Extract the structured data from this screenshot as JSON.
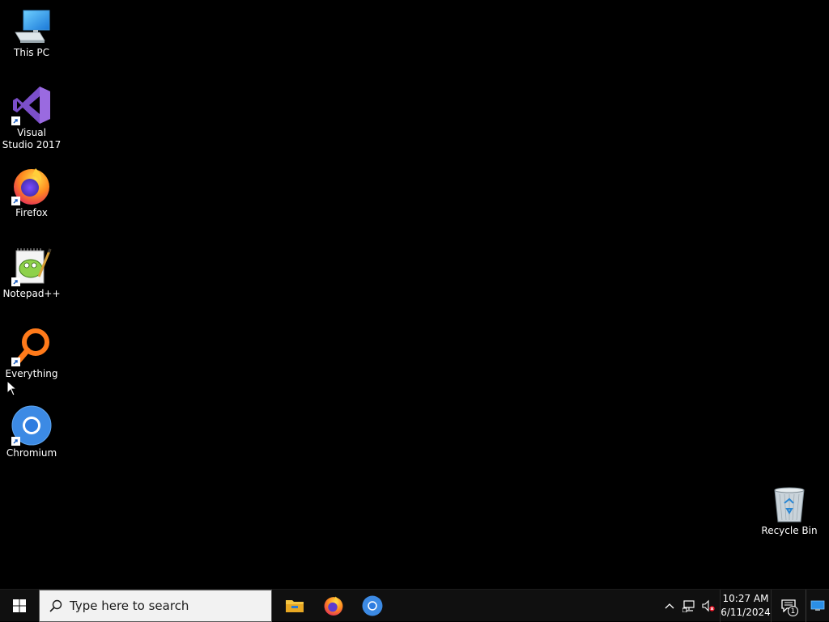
{
  "desktop": {
    "icons": [
      {
        "label": "This PC"
      },
      {
        "label": "Visual Studio 2017"
      },
      {
        "label": "Firefox"
      },
      {
        "label": "Notepad++"
      },
      {
        "label": "Everything"
      },
      {
        "label": "Chromium"
      },
      {
        "label": "Recycle Bin"
      }
    ]
  },
  "taskbar": {
    "start_icon": "windows-logo-icon",
    "search": {
      "placeholder": "Type here to search",
      "icon": "search-icon"
    },
    "pinned_apps": [
      {
        "name": "File Explorer",
        "icon": "file-explorer-icon"
      },
      {
        "name": "Firefox",
        "icon": "firefox-icon"
      },
      {
        "name": "Chromium",
        "icon": "chromium-icon"
      }
    ],
    "tray": {
      "icons": [
        "chevron-up-icon",
        "network-icon",
        "volume-muted-icon"
      ],
      "time": "10:27 AM",
      "date": "6/11/2024",
      "notification_count": "1"
    }
  },
  "colors": {
    "desktop_bg": "#000000",
    "taskbar_bg": "#101010",
    "search_bg": "#f2f2f2",
    "accent": "#0078d7"
  }
}
